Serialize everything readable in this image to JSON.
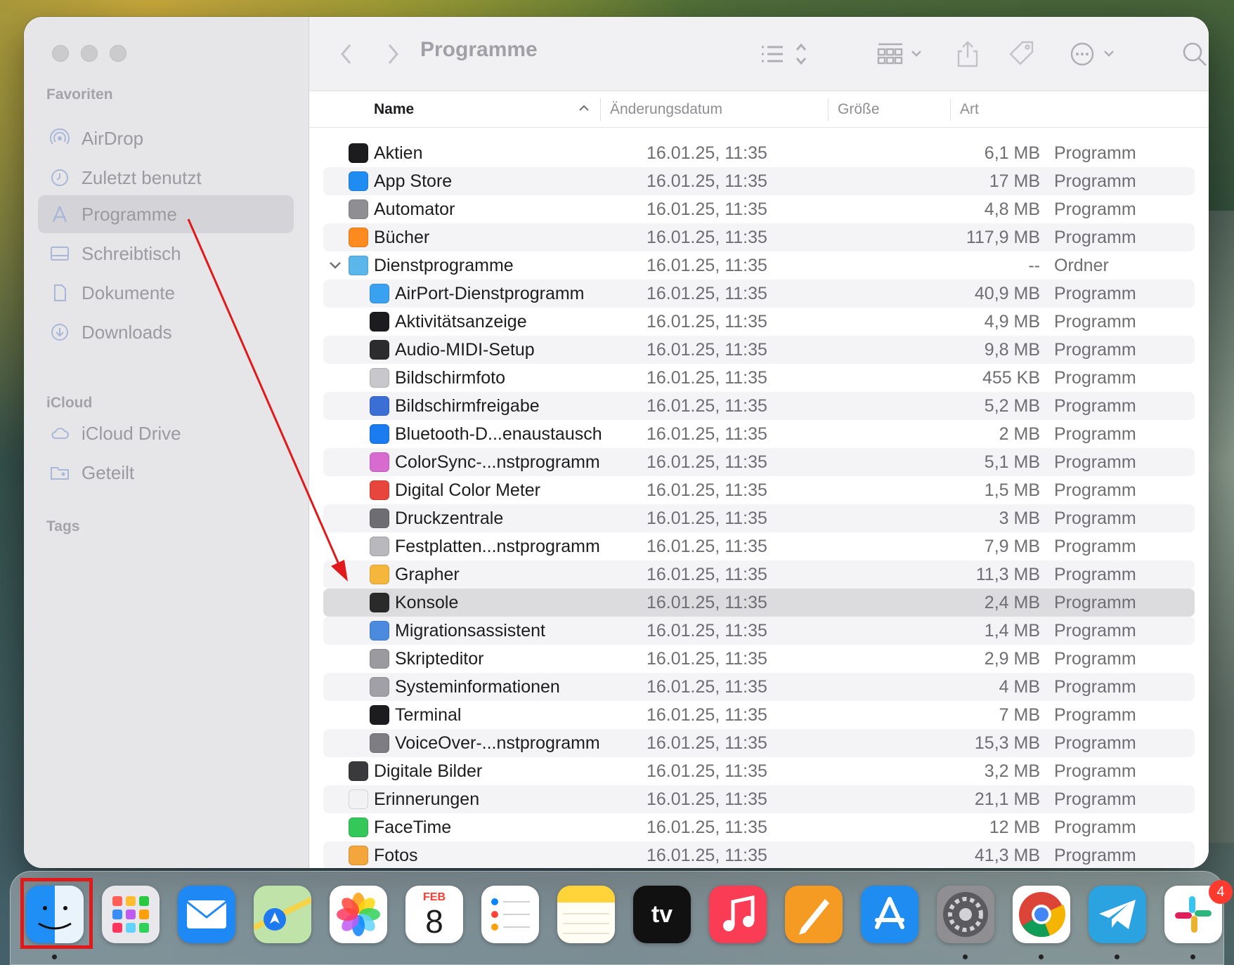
{
  "window": {
    "title": "Programme"
  },
  "sidebar": {
    "favorites_label": "Favoriten",
    "favorites": [
      {
        "label": "AirDrop",
        "icon": "airdrop-icon"
      },
      {
        "label": "Zuletzt benutzt",
        "icon": "clock-icon"
      },
      {
        "label": "Programme",
        "icon": "applications-icon",
        "active": true
      },
      {
        "label": "Schreibtisch",
        "icon": "desktop-icon"
      },
      {
        "label": "Dokumente",
        "icon": "document-icon"
      },
      {
        "label": "Downloads",
        "icon": "download-icon"
      }
    ],
    "icloud_label": "iCloud",
    "icloud": [
      {
        "label": "iCloud Drive",
        "icon": "cloud-icon"
      },
      {
        "label": "Geteilt",
        "icon": "shared-folder-icon"
      }
    ],
    "tags_label": "Tags"
  },
  "columns": {
    "name": "Name",
    "date": "Änderungsdatum",
    "size": "Größe",
    "kind": "Art"
  },
  "rows": [
    {
      "name": "Aktien",
      "date": "16.01.25, 11:35",
      "size": "6,1 MB",
      "kind": "Programm",
      "icon_color": "#1c1c1e",
      "level": 0
    },
    {
      "name": "App Store",
      "date": "16.01.25, 11:35",
      "size": "17 MB",
      "kind": "Programm",
      "icon_color": "#1f8cf2",
      "level": 0
    },
    {
      "name": "Automator",
      "date": "16.01.25, 11:35",
      "size": "4,8 MB",
      "kind": "Programm",
      "icon_color": "#8e8e93",
      "level": 0
    },
    {
      "name": "Bücher",
      "date": "16.01.25, 11:35",
      "size": "117,9 MB",
      "kind": "Programm",
      "icon_color": "#ff8a1f",
      "level": 0
    },
    {
      "name": "Dienstprogramme",
      "date": "16.01.25, 11:35",
      "size": "--",
      "kind": "Ordner",
      "icon_color": "#5bb6ea",
      "level": 0,
      "expanded": true
    },
    {
      "name": "AirPort-Dienstprogramm",
      "date": "16.01.25, 11:35",
      "size": "40,9 MB",
      "kind": "Programm",
      "icon_color": "#3aa0f0",
      "level": 1
    },
    {
      "name": "Aktivitätsanzeige",
      "date": "16.01.25, 11:35",
      "size": "4,9 MB",
      "kind": "Programm",
      "icon_color": "#1c1c1e",
      "level": 1
    },
    {
      "name": "Audio-MIDI-Setup",
      "date": "16.01.25, 11:35",
      "size": "9,8 MB",
      "kind": "Programm",
      "icon_color": "#2c2c2e",
      "level": 1
    },
    {
      "name": "Bildschirmfoto",
      "date": "16.01.25, 11:35",
      "size": "455 KB",
      "kind": "Programm",
      "icon_color": "#c7c7cc",
      "level": 1
    },
    {
      "name": "Bildschirmfreigabe",
      "date": "16.01.25, 11:35",
      "size": "5,2 MB",
      "kind": "Programm",
      "icon_color": "#3b6fd6",
      "level": 1
    },
    {
      "name": "Bluetooth-D...enaustausch",
      "date": "16.01.25, 11:35",
      "size": "2 MB",
      "kind": "Programm",
      "icon_color": "#1a7cf0",
      "level": 1
    },
    {
      "name": "ColorSync-...nstprogramm",
      "date": "16.01.25, 11:35",
      "size": "5,1 MB",
      "kind": "Programm",
      "icon_color": "#d86bd0",
      "level": 1
    },
    {
      "name": "Digital Color Meter",
      "date": "16.01.25, 11:35",
      "size": "1,5 MB",
      "kind": "Programm",
      "icon_color": "#e8453c",
      "level": 1
    },
    {
      "name": "Druckzentrale",
      "date": "16.01.25, 11:35",
      "size": "3 MB",
      "kind": "Programm",
      "icon_color": "#6d6d72",
      "level": 1
    },
    {
      "name": "Festplatten...nstprogramm",
      "date": "16.01.25, 11:35",
      "size": "7,9 MB",
      "kind": "Programm",
      "icon_color": "#b8b8bd",
      "level": 1
    },
    {
      "name": "Grapher",
      "date": "16.01.25, 11:35",
      "size": "11,3 MB",
      "kind": "Programm",
      "icon_color": "#f5b73b",
      "level": 1
    },
    {
      "name": "Konsole",
      "date": "16.01.25, 11:35",
      "size": "2,4 MB",
      "kind": "Programm",
      "icon_color": "#2a2a2a",
      "level": 1,
      "selected": true
    },
    {
      "name": "Migrationsassistent",
      "date": "16.01.25, 11:35",
      "size": "1,4 MB",
      "kind": "Programm",
      "icon_color": "#4a8be0",
      "level": 1
    },
    {
      "name": "Skripteditor",
      "date": "16.01.25, 11:35",
      "size": "2,9 MB",
      "kind": "Programm",
      "icon_color": "#9a9a9f",
      "level": 1
    },
    {
      "name": "Systeminformationen",
      "date": "16.01.25, 11:35",
      "size": "4 MB",
      "kind": "Programm",
      "icon_color": "#a0a0a6",
      "level": 1
    },
    {
      "name": "Terminal",
      "date": "16.01.25, 11:35",
      "size": "7 MB",
      "kind": "Programm",
      "icon_color": "#1c1c1e",
      "level": 1
    },
    {
      "name": "VoiceOver-...nstprogramm",
      "date": "16.01.25, 11:35",
      "size": "15,3 MB",
      "kind": "Programm",
      "icon_color": "#7d7d82",
      "level": 1
    },
    {
      "name": "Digitale Bilder",
      "date": "16.01.25, 11:35",
      "size": "3,2 MB",
      "kind": "Programm",
      "icon_color": "#3a3a3c",
      "level": 0
    },
    {
      "name": "Erinnerungen",
      "date": "16.01.25, 11:35",
      "size": "21,1 MB",
      "kind": "Programm",
      "icon_color": "#f2f2f4",
      "level": 0
    },
    {
      "name": "FaceTime",
      "date": "16.01.25, 11:35",
      "size": "12 MB",
      "kind": "Programm",
      "icon_color": "#34c759",
      "level": 0
    },
    {
      "name": "Fotos",
      "date": "16.01.25, 11:35",
      "size": "41,3 MB",
      "kind": "Programm",
      "icon_color": "#f3a63b",
      "level": 0
    }
  ],
  "dock": {
    "calendar_month": "FEB",
    "calendar_day": "8",
    "tv_label": "tv",
    "slack_badge": "4",
    "apps": [
      {
        "name": "finder-icon",
        "color": "#2f8ff6"
      },
      {
        "name": "launchpad-icon",
        "color": "#e8e8ec"
      },
      {
        "name": "mail-icon",
        "color": "#1e88f5"
      },
      {
        "name": "maps-icon",
        "color": "#58c86d"
      },
      {
        "name": "photos-icon",
        "color": "#ffffff"
      },
      {
        "name": "calendar-icon",
        "color": "#ffffff"
      },
      {
        "name": "reminders-icon",
        "color": "#ffffff"
      },
      {
        "name": "notes-icon",
        "color": "#ffd43b"
      },
      {
        "name": "apple-tv-icon",
        "color": "#111111"
      },
      {
        "name": "music-icon",
        "color": "#fa3c55"
      },
      {
        "name": "pages-icon",
        "color": "#f59a23"
      },
      {
        "name": "app-store-icon",
        "color": "#1f8cf2"
      },
      {
        "name": "system-settings-icon",
        "color": "#8e8e93"
      },
      {
        "name": "chrome-icon",
        "color": "#ffffff"
      },
      {
        "name": "telegram-icon",
        "color": "#2aa3e0"
      },
      {
        "name": "slack-icon",
        "color": "#ffffff"
      }
    ]
  },
  "annotation": {
    "arrow_color": "#e01a1a",
    "box_color": "#e01a1a"
  }
}
